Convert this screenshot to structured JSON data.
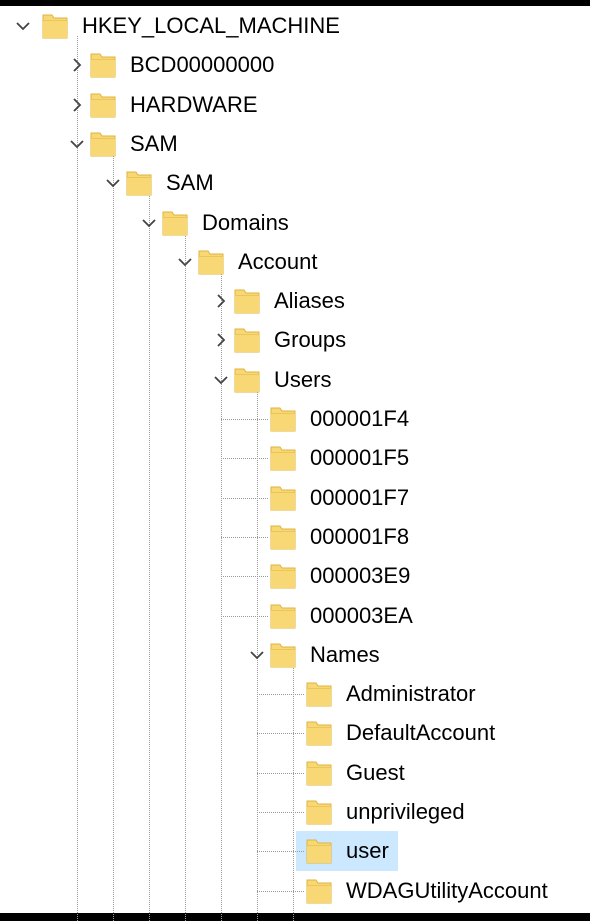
{
  "tree": {
    "nodes": [
      {
        "id": "hklm",
        "label": "HKEY_LOCAL_MACHINE",
        "level": 0,
        "state": "expanded"
      },
      {
        "id": "bcd",
        "label": "BCD00000000",
        "level": 1,
        "state": "collapsed"
      },
      {
        "id": "hardware",
        "label": "HARDWARE",
        "level": 1,
        "state": "collapsed"
      },
      {
        "id": "sam",
        "label": "SAM",
        "level": 1,
        "state": "expanded"
      },
      {
        "id": "sam-sam",
        "label": "SAM",
        "level": 2,
        "state": "expanded"
      },
      {
        "id": "domains",
        "label": "Domains",
        "level": 3,
        "state": "expanded"
      },
      {
        "id": "account",
        "label": "Account",
        "level": 4,
        "state": "expanded"
      },
      {
        "id": "aliases",
        "label": "Aliases",
        "level": 5,
        "state": "collapsed"
      },
      {
        "id": "groups",
        "label": "Groups",
        "level": 5,
        "state": "collapsed"
      },
      {
        "id": "users",
        "label": "Users",
        "level": 5,
        "state": "expanded"
      },
      {
        "id": "u1f4",
        "label": "000001F4",
        "level": 6,
        "state": "leaf"
      },
      {
        "id": "u1f5",
        "label": "000001F5",
        "level": 6,
        "state": "leaf"
      },
      {
        "id": "u1f7",
        "label": "000001F7",
        "level": 6,
        "state": "leaf"
      },
      {
        "id": "u1f8",
        "label": "000001F8",
        "level": 6,
        "state": "leaf"
      },
      {
        "id": "u3e9",
        "label": "000003E9",
        "level": 6,
        "state": "leaf"
      },
      {
        "id": "u3ea",
        "label": "000003EA",
        "level": 6,
        "state": "leaf"
      },
      {
        "id": "names",
        "label": "Names",
        "level": 6,
        "state": "expanded"
      },
      {
        "id": "n-admin",
        "label": "Administrator",
        "level": 7,
        "state": "leaf"
      },
      {
        "id": "n-default",
        "label": "DefaultAccount",
        "level": 7,
        "state": "leaf"
      },
      {
        "id": "n-guest",
        "label": "Guest",
        "level": 7,
        "state": "leaf"
      },
      {
        "id": "n-unpriv",
        "label": "unprivileged",
        "level": 7,
        "state": "leaf"
      },
      {
        "id": "n-user",
        "label": "user",
        "level": 7,
        "state": "leaf",
        "selected": true
      },
      {
        "id": "n-wdag",
        "label": "WDAGUtilityAccount",
        "level": 7,
        "state": "leaf"
      }
    ]
  },
  "colors": {
    "folder_fill": "#f8d775",
    "folder_edge": "#e0b33c",
    "selection": "#cce8ff",
    "connector": "#9a9a9a",
    "chevron": "#444444"
  },
  "icons": {
    "folder": "folder-icon",
    "expanded": "chevron-down-icon",
    "collapsed": "chevron-right-icon"
  }
}
